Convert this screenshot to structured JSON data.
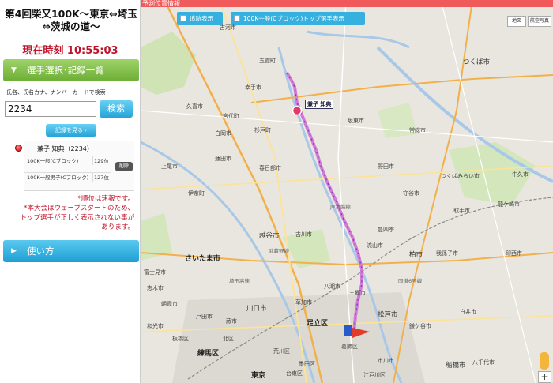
{
  "race": {
    "title": "第4回柴又100K～東京⇔埼玉⇔茨城の道～"
  },
  "clock": {
    "text": "現在時刻 10:55:03"
  },
  "panel": {
    "select_section": "選手選択･記録一覧",
    "search_note": "氏名、氏名カナ、ナンバーカードで検索",
    "search_value": "2234",
    "search_button": "検索",
    "records_button": "記録を見る ›",
    "runner": {
      "name": "兼子 知典（2234）"
    },
    "categories": [
      {
        "name": "100K一般(Cブロック)",
        "count": "129位"
      },
      {
        "name": "100K一般男子(Cブロック)",
        "count": "127位"
      }
    ],
    "delete_button": "削除",
    "notices": [
      "*順位は速報です。",
      "*本大会はウェーブスタートのため、",
      "トップ選手が正しく表示されない事が",
      "あります。"
    ],
    "usage_section": "使い方"
  },
  "map": {
    "header": "予測位置情報",
    "toggles": [
      {
        "label": "追跡表示"
      },
      {
        "label": "100K一般(Cブロック)トップ選手表示"
      }
    ],
    "maptype": {
      "map": "地図",
      "satellite": "航空写真"
    },
    "runner_label": "兼子 知典",
    "zoom_label": "+",
    "places": {
      "goka": "五霞町",
      "sachite": "幸手市",
      "koga": "古河市",
      "tsukuba": "つくば市",
      "bando": "坂東市",
      "joso": "常総市",
      "satte": "杉戸町",
      "shiraoka": "白岡市",
      "kasukabe": "春日部市",
      "tsukubamirai": "つくばみらい市",
      "moriya": "守谷市",
      "ageo": "上尾市",
      "hasuda": "蓮田市",
      "noda": "野田市",
      "toride": "取手市",
      "kawagoe": "川越市",
      "saitama": "さいたま市",
      "koshigaya": "越谷市",
      "yoshikawa": "吉川市",
      "nagareyama": "流山市",
      "kashiwa": "柏市",
      "abiko": "我孫子市",
      "kawaguchi": "川口市",
      "soka": "草加市",
      "misato": "三郷市",
      "matsudo": "松戸市",
      "adachi": "足立区",
      "katsushika": "葛飾区",
      "nerima": "練馬区",
      "tokyo": "東京",
      "taito": "台東区",
      "funabashi": "船橋市",
      "ichikawa": "市川市",
      "inzai": "印西市",
      "shiroi": "白井市",
      "kamagaya": "鎌ケ谷市",
      "yachiyo": "八千代市",
      "ushiku": "牛久市",
      "ryugasaki": "龍ケ崎市",
      "toda": "戸田市",
      "warabi": "蕨市",
      "asaka": "朝霞市",
      "wako": "和光市",
      "itabashi": "板橋区",
      "kita": "北区",
      "arakawa": "荒川区",
      "sumida": "墨田区",
      "edogawa": "江戸川区",
      "kuki": "久喜市",
      "ina": "伊奈町",
      "miyashiro": "宮代町",
      "yashio": "八潮市",
      "shiki": "志木市",
      "fujimi": "富士見市",
      "toyoshiki": "豊四季",
      "musashino_line": "武蔵野線",
      "jr_joban": "JR常磐線",
      "kashiwa_road": "国道6号線",
      "shinagawa_line": "埼玉高速"
    }
  }
}
